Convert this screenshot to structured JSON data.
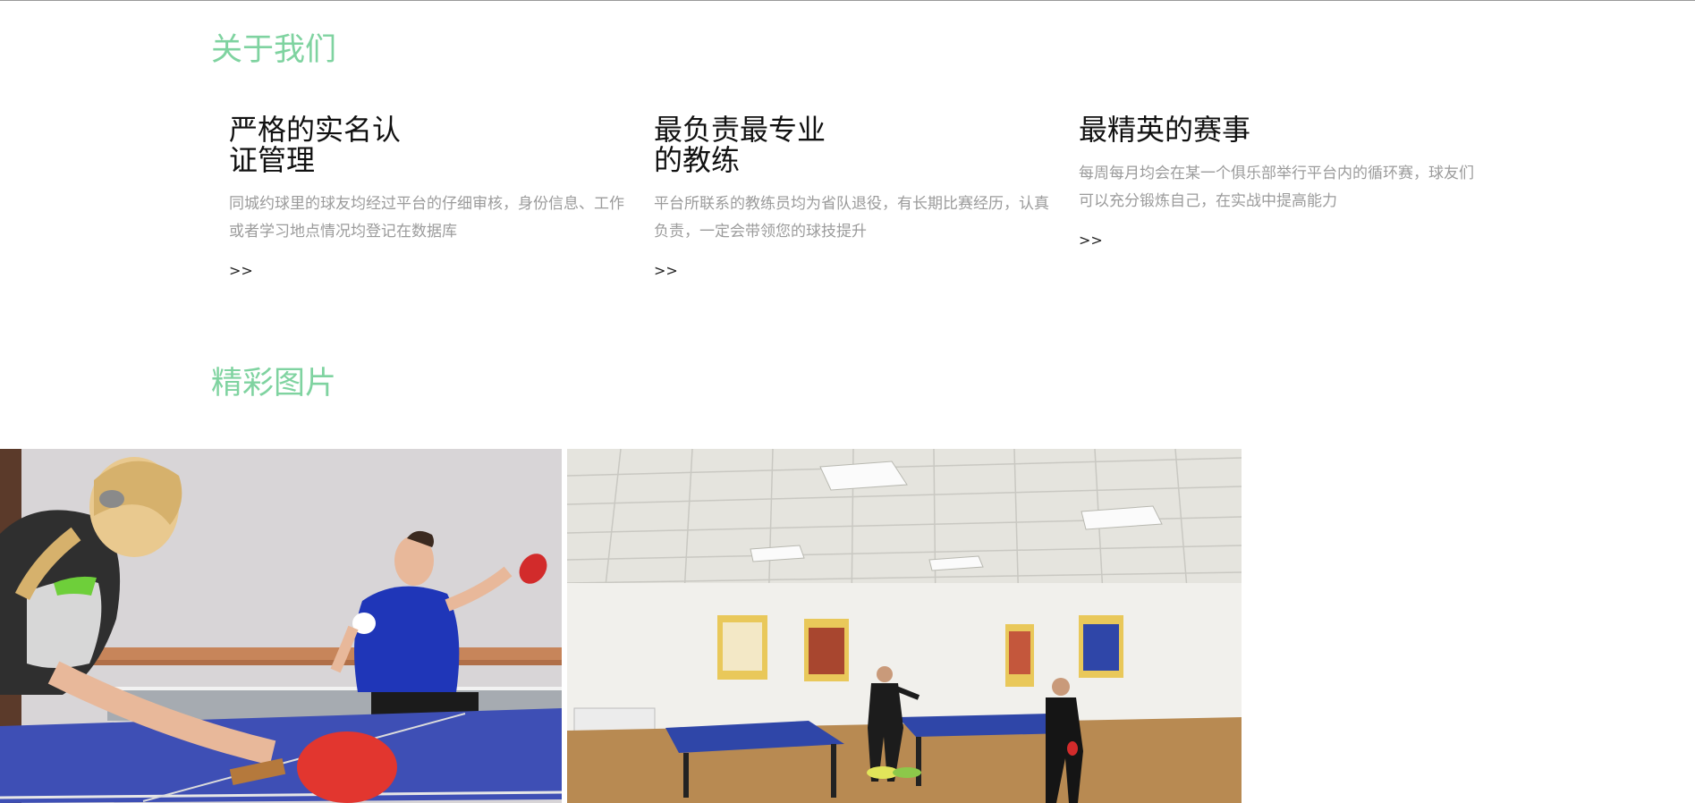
{
  "about": {
    "title": "关于我们",
    "features": [
      {
        "title_line1": "严格的实名认",
        "title_line2": "证管理",
        "desc": "同城约球里的球友均经过平台的仔细审核，身份信息、工作或者学习地点情况均登记在数据库",
        "more": ">>"
      },
      {
        "title_line1": "最负责最专业",
        "title_line2": "的教练",
        "desc": "平台所联系的教练员均为省队退役，有长期比赛经历，认真负责，一定会带领您的球技提升",
        "more": ">>"
      },
      {
        "title_line1": "最精英的赛事",
        "title_line2": "",
        "desc": "每周每月均会在某一个俱乐部举行平台内的循环赛，球友们可以充分锻炼自己，在实战中提高能力",
        "more": ">>"
      }
    ]
  },
  "gallery": {
    "title": "精彩图片",
    "photos": [
      {
        "subject": "table-tennis-match-close-up"
      },
      {
        "subject": "table-tennis-training-hall"
      }
    ]
  },
  "colors": {
    "accent": "#7fd3a0",
    "heading": "#111111",
    "muted_text": "#9b9b9b",
    "table_blue": "#2f46a8",
    "paddle_red": "#e2362f"
  }
}
